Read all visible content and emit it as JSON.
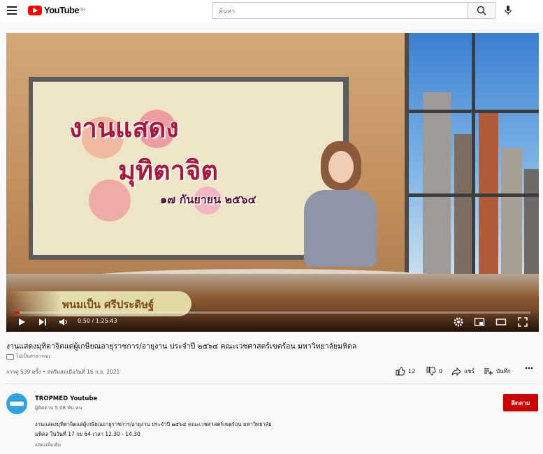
{
  "header": {
    "logo_text": "YouTube",
    "logo_sup": "TH",
    "search_placeholder": "ค้นหา"
  },
  "player": {
    "lower_third": "พนมเป็น ศรีประดิษฐ์",
    "time_current": "0:50",
    "time_total": "1:25:43",
    "time_display": "0:50 / 1:25:43",
    "progress": 0.0097,
    "title_card_line1": "งานแสดง",
    "title_card_line2": "มุทิตาจิต",
    "title_card_date": "๑๗ กันยายน ๒๕๖๔"
  },
  "video": {
    "title": "งานแสดงมุทิตาจิตแด่ผู้เกษียณอายุราชการ/อายุงาน ประจำปี ๒๕๖๔ คณะเวชศาสตร์เขตร้อน มหาวิทยาลัยมหิดล",
    "badge": "ไม่เป็นสาธารณะ",
    "meta": "การดู 539 ครั้ง • สตรีมสดเมื่อวันที่ 16 ก.ย. 2021",
    "likes": "12",
    "dislikes": "0",
    "share_label": "แชร์",
    "save_label": "บันทึก"
  },
  "channel": {
    "name": "TROPMED Youtube",
    "subscribers": "ผู้ติดตาม 5.08 พัน คน",
    "subscribe_label": "ติดตาม"
  },
  "description": {
    "line1": "งานแสดงมุทิตาจิตแด่ผู้เกษียณอายุราชการ/อายุงาน ประจำปี ๒๕๖๔ คณะเวชศาสตร์เขตร้อน มหาวิทยาลัย",
    "line2": "มหิดล ในวันที่ 17 กย 64 เวลา 12.30 - 14.30",
    "show_more": "แสดงเพิ่มเติม"
  },
  "colors": {
    "brand_red": "#ff0000",
    "subscribe_red": "#cc0000"
  }
}
